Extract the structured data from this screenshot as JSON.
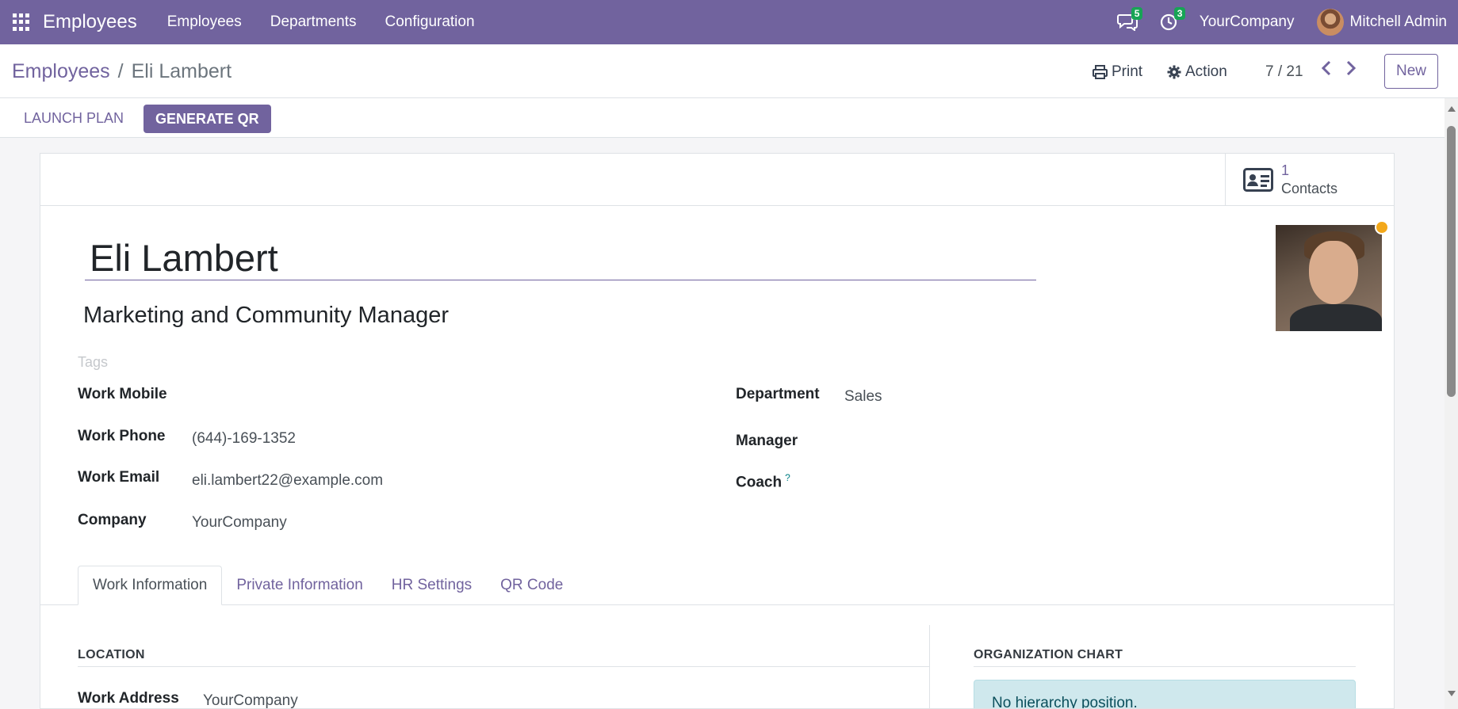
{
  "app": {
    "title": "Employees",
    "menu": [
      "Employees",
      "Departments",
      "Configuration"
    ],
    "messages_count": "5",
    "activities_count": "3",
    "company": "YourCompany",
    "user": "Mitchell Admin"
  },
  "control": {
    "breadcrumb_parent": "Employees",
    "breadcrumb_sep": "/",
    "breadcrumb_current": "Eli Lambert",
    "print_label": "Print",
    "action_label": "Action",
    "pager": "7 / 21",
    "new_label": "New"
  },
  "actions": {
    "launch_plan": "LAUNCH PLAN",
    "generate_qr": "GENERATE QR"
  },
  "smart_button": {
    "count": "1",
    "label": "Contacts"
  },
  "employee": {
    "name": "Eli Lambert",
    "job_title": "Marketing and Community Manager",
    "tags_placeholder": "Tags",
    "status_color": "#f3a81a"
  },
  "fields": {
    "work_mobile_label": "Work Mobile",
    "work_mobile_value": "",
    "work_phone_label": "Work Phone",
    "work_phone_value": "(644)-169-1352",
    "work_email_label": "Work Email",
    "work_email_value": "eli.lambert22@example.com",
    "company_label": "Company",
    "company_value": "YourCompany",
    "department_label": "Department",
    "department_value": "Sales",
    "manager_label": "Manager",
    "manager_value": "",
    "coach_label": "Coach",
    "coach_help": "?",
    "coach_value": ""
  },
  "tabs": [
    "Work Information",
    "Private Information",
    "HR Settings",
    "QR Code"
  ],
  "work_info": {
    "location_title": "LOCATION",
    "work_address_label": "Work Address",
    "work_address_value": "YourCompany",
    "org_chart_title": "ORGANIZATION CHART",
    "org_chart_text": "No hierarchy position."
  },
  "colors": {
    "brand": "#71639e",
    "badge": "#17a455"
  }
}
